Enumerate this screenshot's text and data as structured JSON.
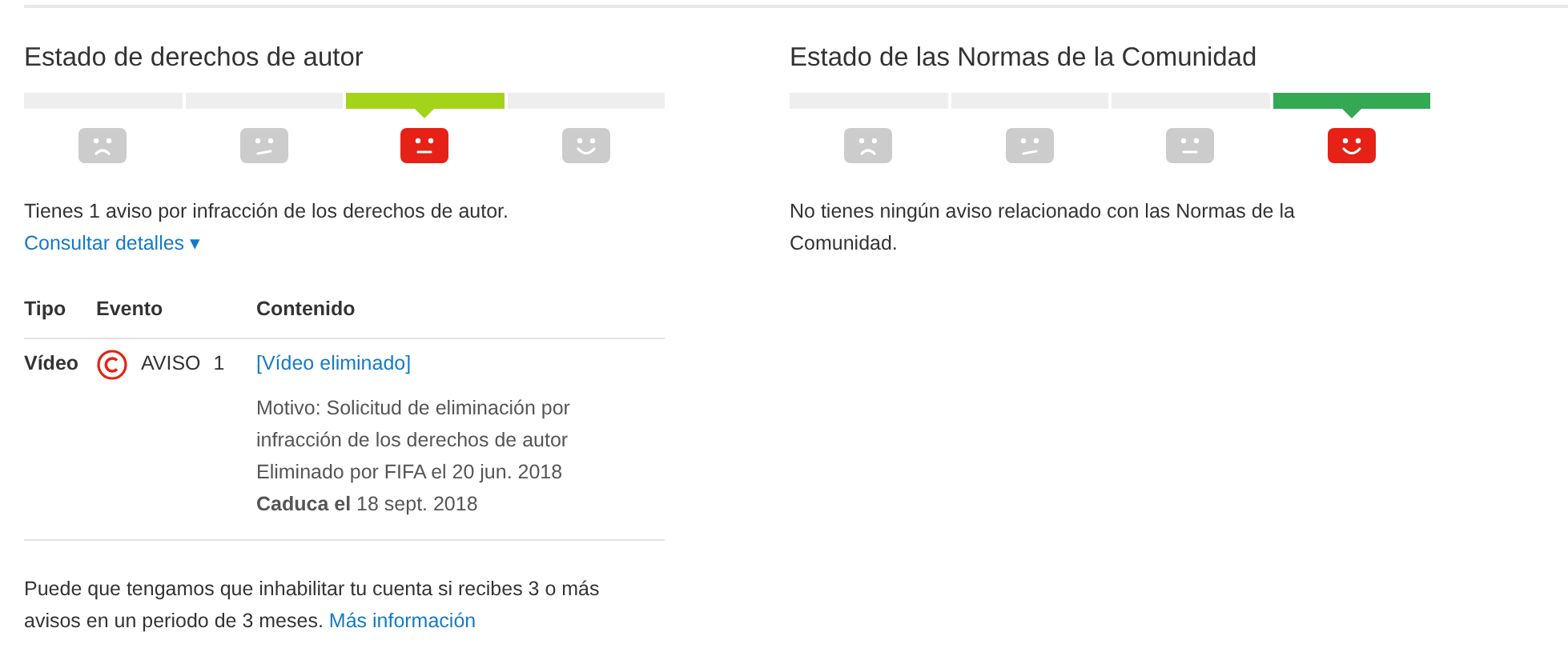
{
  "copyright": {
    "title": "Estado de derechos de autor",
    "levels": [
      {
        "selected": false,
        "color": "#eeeeee",
        "kind": "sad",
        "active": false
      },
      {
        "selected": false,
        "color": "#eeeeee",
        "kind": "unsure",
        "active": false
      },
      {
        "selected": true,
        "color": "#a4d41a",
        "kind": "neutral",
        "active": true
      },
      {
        "selected": false,
        "color": "#eeeeee",
        "kind": "happy",
        "active": false
      }
    ],
    "summary": "Tienes 1 aviso por infracción de los derechos de autor.",
    "details_link": "Consultar detalles",
    "details_caret": "▾",
    "table": {
      "columns": [
        "Tipo",
        "Evento",
        "Contenido"
      ],
      "rows": [
        {
          "type": "Vídeo",
          "event": "AVISO",
          "count": "1",
          "content_link": "[Vídeo eliminado]",
          "reason": "Motivo: Solicitud de eliminación por infracción de los derechos de autor",
          "removed": "Eliminado por FIFA el 20 jun. 2018",
          "expires": "**Caduca el** 18 sept. 2018"
        }
      ]
    },
    "footer": "Puede que tengamos que inhabilitar tu cuenta si recibes 3 o más avisos en un periodo de 3 meses.",
    "footer_link": "Más información"
  },
  "community": {
    "title": "Estado de las Normas de la Comunidad",
    "levels": [
      {
        "selected": false,
        "color": "#eeeeee",
        "kind": "sad",
        "active": false
      },
      {
        "selected": false,
        "color": "#eeeeee",
        "kind": "unsure",
        "active": false
      },
      {
        "selected": false,
        "color": "#eeeeee",
        "kind": "neutral",
        "active": false
      },
      {
        "selected": true,
        "color": "#34a853",
        "kind": "happy",
        "active": true
      }
    ],
    "summary": "No tienes ningún aviso relacionado con las Normas de la Comunidad."
  }
}
